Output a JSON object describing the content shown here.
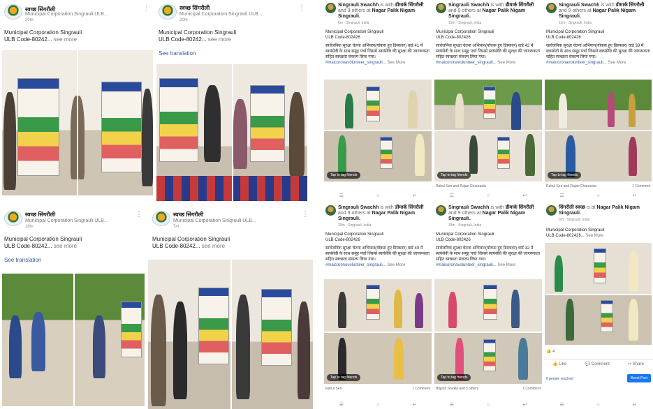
{
  "left_posts": [
    {
      "page": "स्वच्छ सिंगरौली",
      "sub": "Municipal Corporation Singrauli ULB...",
      "time": "20m",
      "caption1": "Municipal Corporation Singrauli",
      "caption2": "ULB Code-80242...",
      "more": "see more",
      "show_translation": false
    },
    {
      "page": "स्वच्छ सिंगरौली",
      "sub": "Municipal Corporation Singrauli ULB...",
      "time": "20m",
      "caption1": "Municipal Corporation Singrauli",
      "caption2": "ULB Code-80242...",
      "more": "see more",
      "show_translation": true
    },
    {
      "page": "स्वच्छ सिंगरौली",
      "sub": "Municipal Corporation Singrauli ULB...",
      "time": "18m",
      "caption1": "Municipal Corporation Singrauli",
      "caption2": "ULB Code-80242...",
      "more": "see more",
      "show_translation": true
    },
    {
      "page": "स्वच्छ सिंगरौली",
      "sub": "Municipal Corporation Singrauli ULB...",
      "time": "7m",
      "caption1": "Municipal Corporation Singrauli",
      "caption2": "ULB Code-80242...",
      "more": "see more",
      "show_translation": false
    }
  ],
  "see_translation": "See translation",
  "fb_posts": [
    {
      "name": "Singrauli Swachh",
      "with": "is with",
      "tagged": "डीमार्क सिंगरौली",
      "and": "and 9 others at",
      "place": "Nagar Palik Nigam Singrauli.",
      "time": "6m · Singrauli, India",
      "cap1": "Municipal Corporation Singrauli",
      "cap2": "ULB Code-802426",
      "hindi": "सार्वजनिक सुरक्षा चेतना अभियान(योकस हुए डिस्कवर) वार्ड 41 में स्वयंसेवी के साथ समूह पर्चा जिससे स्वयंसेवि की सुरक्षा की जागरूकता सहित स्वच्छता संकल्प लिया गया।",
      "hash": "#maicoronavolunteer_singrauli...",
      "more": "See More",
      "tag": "Tap to tag friends",
      "footer_left": "",
      "footer_right": ""
    },
    {
      "name": "Singrauli Swachh",
      "with": "is with",
      "tagged": "डीमार्क सिंगरौली",
      "and": "and 9 others at",
      "place": "Nagar Palik Nigam Singrauli.",
      "time": "13m · Singrauli, India",
      "cap1": "Municipal Corporation Singrauli",
      "cap2": "ULB Code-802426",
      "hindi": "सार्वजनिक सुरक्षा चेतना अभियान(योकस हुए डिस्कवर) वार्ड 42 में स्वयंसेवी के साथ समूह पर्चा जिससे स्वयंसेवि की सुरक्षा की जागरूकता सहित स्वच्छता संकल्प लिया गया।",
      "hash": "#maicoronavolunteer_singrauli...",
      "more": "See More",
      "tag": "Tap to tag friends",
      "footer_left": "Rahul Sen and Rajan Chaurasia",
      "footer_right": ""
    },
    {
      "name": "Singrauli Swachh",
      "with": "is with",
      "tagged": "डीमार्क सिंगरौली",
      "and": "and 9 others at",
      "place": "Nagar Palik Nigam Singrauli.",
      "time": "11m · Singrauli, India",
      "cap1": "Municipal Corporation Singrauli",
      "cap2": "ULB Code-802426",
      "hindi": "सार्वजनिक सुरक्षा चेतना अभियान(योकस हुए डिस्कवर) वार्ड 39 में स्वयंसेवी के साथ समूह पर्चा जिससे स्वयंसेवि की सुरक्षा की जागरूकता सहित स्वच्छता संकल्प लिया गया।",
      "hash": "#maicoronavolunteer_singrauli...",
      "more": "See More",
      "tag": "Tap to tag friends",
      "footer_left": "Rahul Sen and Rajan Chaurasia",
      "footer_right": "1 Comment"
    },
    {
      "name": "Singrauli Swachh",
      "with": "is with",
      "tagged": "डीमार्क सिंगरौली",
      "and": "and 9 others at",
      "place": "Nagar Palik Nigam Singrauli.",
      "time": "20m · Singrauli, India",
      "cap1": "Municipal Corporation Singrauli",
      "cap2": "ULB Code-802426",
      "hindi": "सार्वजनिक सुरक्षा चेतना अभियान(योकस हुए डिस्कवर) वार्ड 40 में स्वयंसेवी के साथ समूह पर्चा जिससे स्वयंसेवि की सुरक्षा की जागरूकता सहित स्वच्छता संकल्प लिया गया।",
      "hash": "#maicoronavolunteer_singrauli...",
      "more": "See More",
      "tag": "Tap to tag friends",
      "footer_left": "Rahul Sen",
      "footer_right": "1 Comment"
    },
    {
      "name": "Singrauli Swachh",
      "with": "is with",
      "tagged": "डीमार्क सिंगरौली",
      "and": "and 9 others at",
      "place": "Nagar Palik Nigam Singrauli.",
      "time": "33m · Singrauli, India",
      "cap1": "Municipal Corporation Singrauli",
      "cap2": "ULB Code-802426",
      "hindi": "सार्वजनिक सुरक्षा चेतना अभियान(योकस हुए डिस्कवर) वार्ड 32 में स्वयंसेवी के साथ समूह पर्चा जिससे स्वयंसेवि की सुरक्षा की जागरूकता सहित स्वच्छता संकल्प लिया गया।",
      "hash": "#maicoronavolunteer_singrauli...",
      "more": "See More",
      "tag": "Tap to tag friends",
      "footer_left": "Brijesh Shukla and 5 others",
      "footer_right": "1 Comment"
    }
  ],
  "last_post": {
    "name": "सिंगरौली स्वच्छ",
    "at": "is at",
    "place": "Nagar Palik Nigam Singrauli.",
    "time": "9m · Singrauli, India",
    "cap1": "Municipal Corporation Singrauli",
    "cap2": "ULB Code-802426...",
    "more": "See More",
    "reaction_count": "4",
    "like": "Like",
    "comment": "Comment",
    "share": "Share",
    "reached": "0 people reached",
    "boost": "Boost Post"
  }
}
